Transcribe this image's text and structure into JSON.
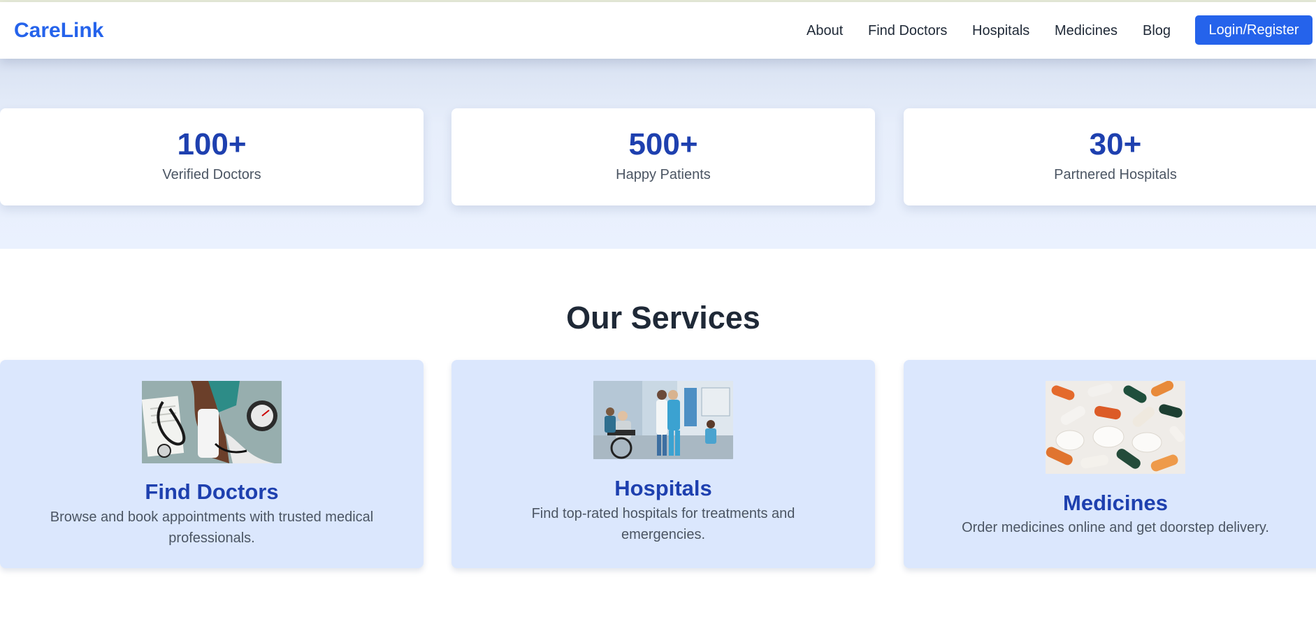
{
  "header": {
    "brand": "CareLink",
    "nav": [
      "About",
      "Find Doctors",
      "Hospitals",
      "Medicines",
      "Blog"
    ],
    "login_label": "Login/Register",
    "brand_color": "#2563eb"
  },
  "stats": [
    {
      "value": "100+",
      "label": "Verified Doctors"
    },
    {
      "value": "500+",
      "label": "Happy Patients"
    },
    {
      "value": "30+",
      "label": "Partnered Hospitals"
    }
  ],
  "services": {
    "title": "Our Services",
    "items": [
      {
        "title": "Find Doctors",
        "description": "Browse and book appointments with trusted medical professionals.",
        "image": "doctor-stethoscope-photo"
      },
      {
        "title": "Hospitals",
        "description": "Find top-rated hospitals for treatments and emergencies.",
        "image": "hospital-ward-photo"
      },
      {
        "title": "Medicines",
        "description": "Order medicines online and get doorstep delivery.",
        "image": "pills-capsules-photo"
      }
    ]
  }
}
